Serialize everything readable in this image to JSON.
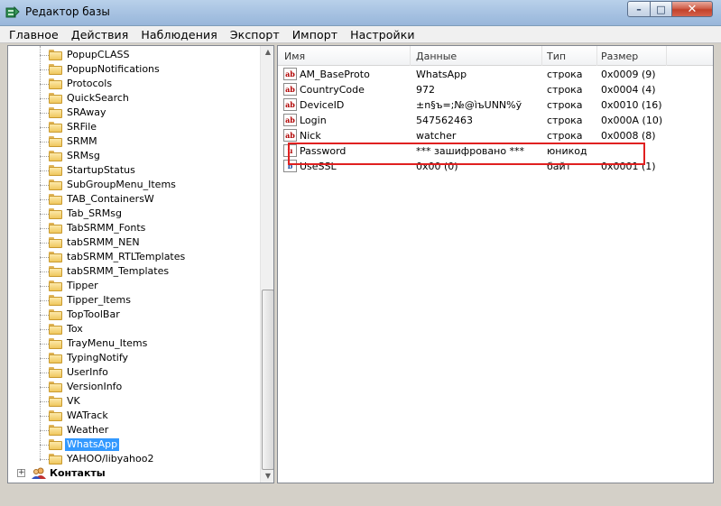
{
  "window": {
    "title": "Редактор базы",
    "min_glyph": "–",
    "max_glyph": "□",
    "close_glyph": "✕"
  },
  "menu": [
    "Главное",
    "Действия",
    "Наблюдения",
    "Экспорт",
    "Импорт",
    "Настройки"
  ],
  "tree": {
    "items": [
      "PopupCLASS",
      "PopupNotifications",
      "Protocols",
      "QuickSearch",
      "SRAway",
      "SRFile",
      "SRMM",
      "SRMsg",
      "StartupStatus",
      "SubGroupMenu_Items",
      "TAB_ContainersW",
      "Tab_SRMsg",
      "TabSRMM_Fonts",
      "tabSRMM_NEN",
      "tabSRMM_RTLTemplates",
      "tabSRMM_Templates",
      "Tipper",
      "Tipper_Items",
      "TopToolBar",
      "Tox",
      "TrayMenu_Items",
      "TypingNotify",
      "UserInfo",
      "VersionInfo",
      "VK",
      "WATrack",
      "Weather",
      "WhatsApp",
      "YAHOO/libyahoo2"
    ],
    "selected": "WhatsApp",
    "contacts_label": "Контакты",
    "expander_glyph": "+"
  },
  "list": {
    "columns": [
      "Имя",
      "Данные",
      "Тип",
      "Размер"
    ],
    "rows": [
      {
        "name": "AM_BaseProto",
        "data": "WhatsApp",
        "type": "строка",
        "size": "0x0009 (9)",
        "icon": "ab"
      },
      {
        "name": "CountryCode",
        "data": "972",
        "type": "строка",
        "size": "0x0004 (4)",
        "icon": "ab"
      },
      {
        "name": "DeviceID",
        "data": "±n§ъ=;№@ìъUNN%ў",
        "type": "строка",
        "size": "0x0010 (16)",
        "icon": "ab"
      },
      {
        "name": "Login",
        "data": "547562463",
        "type": "строка",
        "size": "0x000A (10)",
        "icon": "ab"
      },
      {
        "name": "Nick",
        "data": "watcher",
        "type": "строка",
        "size": "0x0008 (8)",
        "icon": "ab"
      },
      {
        "name": "Password",
        "data": "*** зашифровано ***",
        "type": "юникод",
        "size": "",
        "icon": "u"
      },
      {
        "name": "UseSSL",
        "data": "0x00 (0)",
        "type": "байт",
        "size": "0x0001 (1)",
        "icon": "b"
      }
    ]
  },
  "colors": {
    "selection": "#3399ff",
    "highlight_box": "#e02020"
  }
}
